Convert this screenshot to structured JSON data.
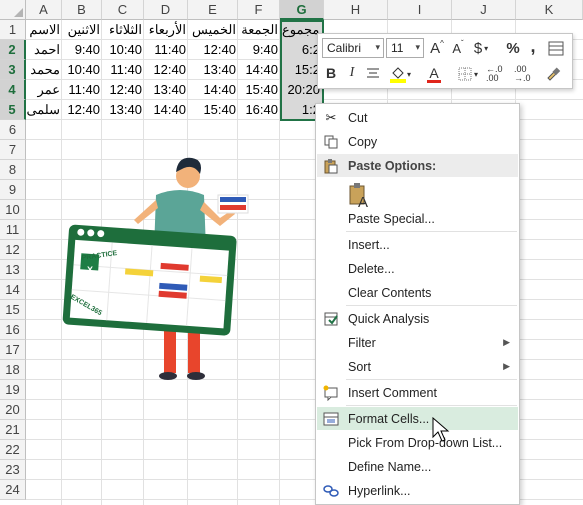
{
  "columns": [
    "A",
    "B",
    "C",
    "D",
    "E",
    "F",
    "G",
    "H",
    "I",
    "J",
    "K"
  ],
  "rows": [
    "1",
    "2",
    "3",
    "4",
    "5",
    "6",
    "7",
    "8",
    "9",
    "10",
    "11",
    "12",
    "13",
    "14",
    "15",
    "16",
    "17",
    "18",
    "19",
    "20",
    "21",
    "22",
    "23",
    "24"
  ],
  "selected_column": "G",
  "table": {
    "headers": [
      "الاسم",
      "الاثنين",
      "الثلاثاء",
      "الأربعاء",
      "الخميس",
      "الجمعة",
      "مجموع"
    ],
    "rows": [
      {
        "name": "احمد",
        "mon": "9:40",
        "tue": "10:40",
        "wed": "11:40",
        "thu": "12:40",
        "fri": "9:40",
        "total": "6:2"
      },
      {
        "name": "محمد",
        "mon": "10:40",
        "tue": "11:40",
        "wed": "12:40",
        "thu": "13:40",
        "fri": "14:40",
        "total": "15:2"
      },
      {
        "name": "عمر",
        "mon": "11:40",
        "tue": "12:40",
        "wed": "13:40",
        "thu": "14:40",
        "fri": "15:40",
        "total": "20:20"
      },
      {
        "name": "سلمى",
        "mon": "12:40",
        "tue": "13:40",
        "wed": "14:40",
        "thu": "15:40",
        "fri": "16:40",
        "total": "1:2"
      }
    ]
  },
  "illustration": {
    "board_text_1": "PRACTICE",
    "board_text_2": "EXCEL365",
    "logo_letter": "X"
  },
  "mini_toolbar": {
    "font_name": "Calibri",
    "font_size": "11",
    "grow_font": "A",
    "shrink_font": "A",
    "currency": "$",
    "percent": "%",
    "comma": ",",
    "bold": "B",
    "italic": "I",
    "font_color_letter": "A",
    "dec_increase": "←.0 .00",
    "dec_decrease": ".00 →.0"
  },
  "context_menu": {
    "items": [
      {
        "label": "Cut",
        "icon": "scissors-icon"
      },
      {
        "label": "Copy",
        "icon": "copy-icon"
      },
      {
        "label": "Paste Options:",
        "icon": "paste-icon"
      },
      {
        "label": "Paste Special...",
        "icon": ""
      },
      {
        "label": "Insert...",
        "icon": ""
      },
      {
        "label": "Delete...",
        "icon": ""
      },
      {
        "label": "Clear Contents",
        "icon": ""
      },
      {
        "label": "Quick Analysis",
        "icon": "quick-analysis-icon"
      },
      {
        "label": "Filter",
        "icon": ""
      },
      {
        "label": "Sort",
        "icon": ""
      },
      {
        "label": "Insert Comment",
        "icon": "comment-icon"
      },
      {
        "label": "Format Cells...",
        "icon": "format-cells-icon"
      },
      {
        "label": "Pick From Drop-down List...",
        "icon": ""
      },
      {
        "label": "Define Name...",
        "icon": ""
      },
      {
        "label": "Hyperlink...",
        "icon": "hyperlink-icon"
      }
    ],
    "highlighted": "Format Cells..."
  },
  "colors": {
    "excel_green": "#217346",
    "highlight": "#d9ecdf",
    "selection_fill": "#d9d9d9"
  }
}
